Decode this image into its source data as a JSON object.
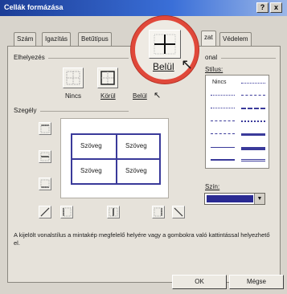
{
  "window": {
    "title": "Cellák formázása",
    "help_label": "?",
    "close_label": "x"
  },
  "tabs": [
    "Szám",
    "Igazítás",
    "Betűtípus",
    "zat",
    "Védelem"
  ],
  "placement": {
    "heading": "Elhelyezés",
    "presets": [
      "Nincs",
      "Körül",
      "Belül"
    ]
  },
  "magnifier": {
    "label": "Belül"
  },
  "border": {
    "heading": "Szegély"
  },
  "preview": {
    "cells": [
      "Szöveg",
      "Szöveg",
      "Szöveg",
      "Szöveg"
    ]
  },
  "line": {
    "heading": "onal",
    "style_label": "Stílus:",
    "none_label": "Nincs",
    "color_label": "Szín:",
    "color_value": "#2a2a92"
  },
  "hint": "A kijelölt vonalstílus a mintakép megfelelő helyére vagy a gombokra való kattintással helyezhető el.",
  "buttons": {
    "ok": "OK",
    "cancel": "Mégse"
  }
}
